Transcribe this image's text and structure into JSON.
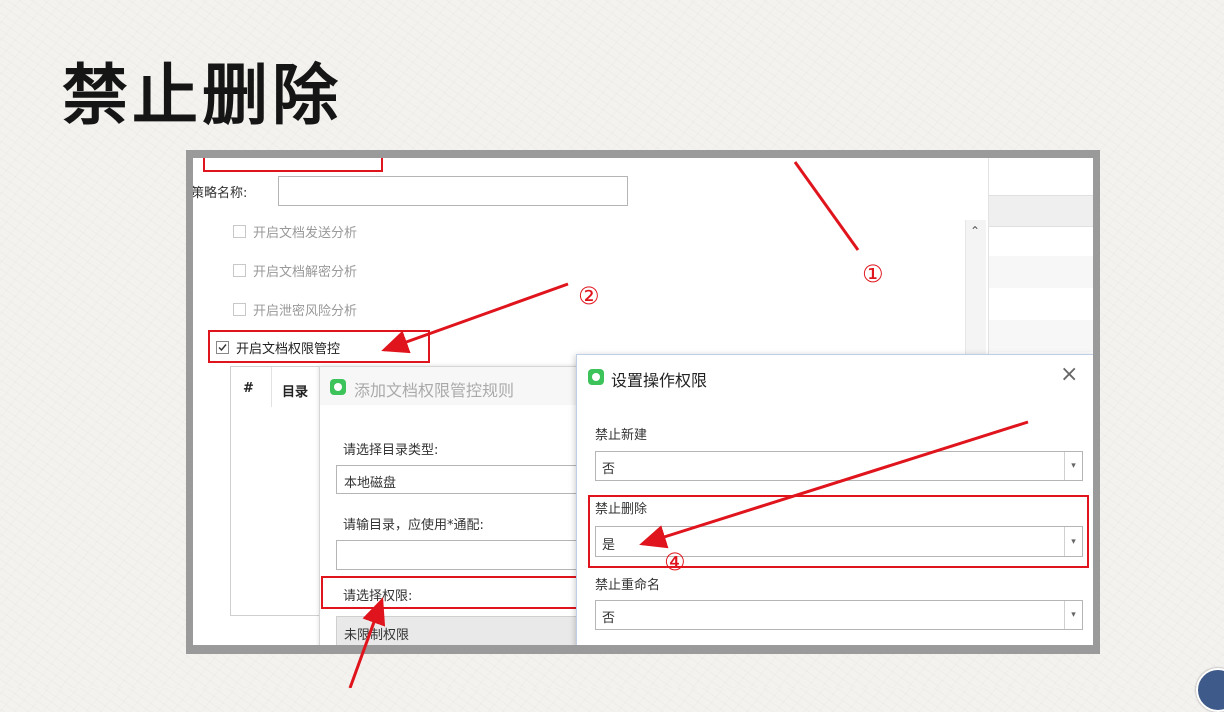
{
  "slide": {
    "title": "禁止删除"
  },
  "policy": {
    "name_label": "策略名称:",
    "name_value": ""
  },
  "checkboxes": [
    {
      "label": "开启文档发送分析",
      "checked": false
    },
    {
      "label": "开启文档解密分析",
      "checked": false
    },
    {
      "label": "开启泄密风险分析",
      "checked": false
    },
    {
      "label": "开启文档权限管控",
      "checked": true
    }
  ],
  "table": {
    "headers": [
      "#",
      "目录"
    ]
  },
  "add_rule_dialog": {
    "title": "添加文档权限管控规则",
    "dir_type_label": "请选择目录类型:",
    "dir_type_value": "本地磁盘",
    "dir_input_label": "请输目录，应使用*通配:",
    "dir_input_value": "",
    "permission_label": "请选择权限:",
    "permission_value": "未限制权限"
  },
  "op_dialog": {
    "title": "设置操作权限",
    "close_glyph": "×",
    "fields": [
      {
        "label": "禁止新建",
        "value": "否"
      },
      {
        "label": "禁止删除",
        "value": "是"
      },
      {
        "label": "禁止重命名",
        "value": "否"
      }
    ]
  },
  "annotations": [
    "①",
    "②",
    "④"
  ],
  "colors": {
    "annotation_red": "#e0141c",
    "dialog_accent": "#3cc35a"
  },
  "icons": {
    "scroll_up": "⌃",
    "dropdown": "▾"
  }
}
